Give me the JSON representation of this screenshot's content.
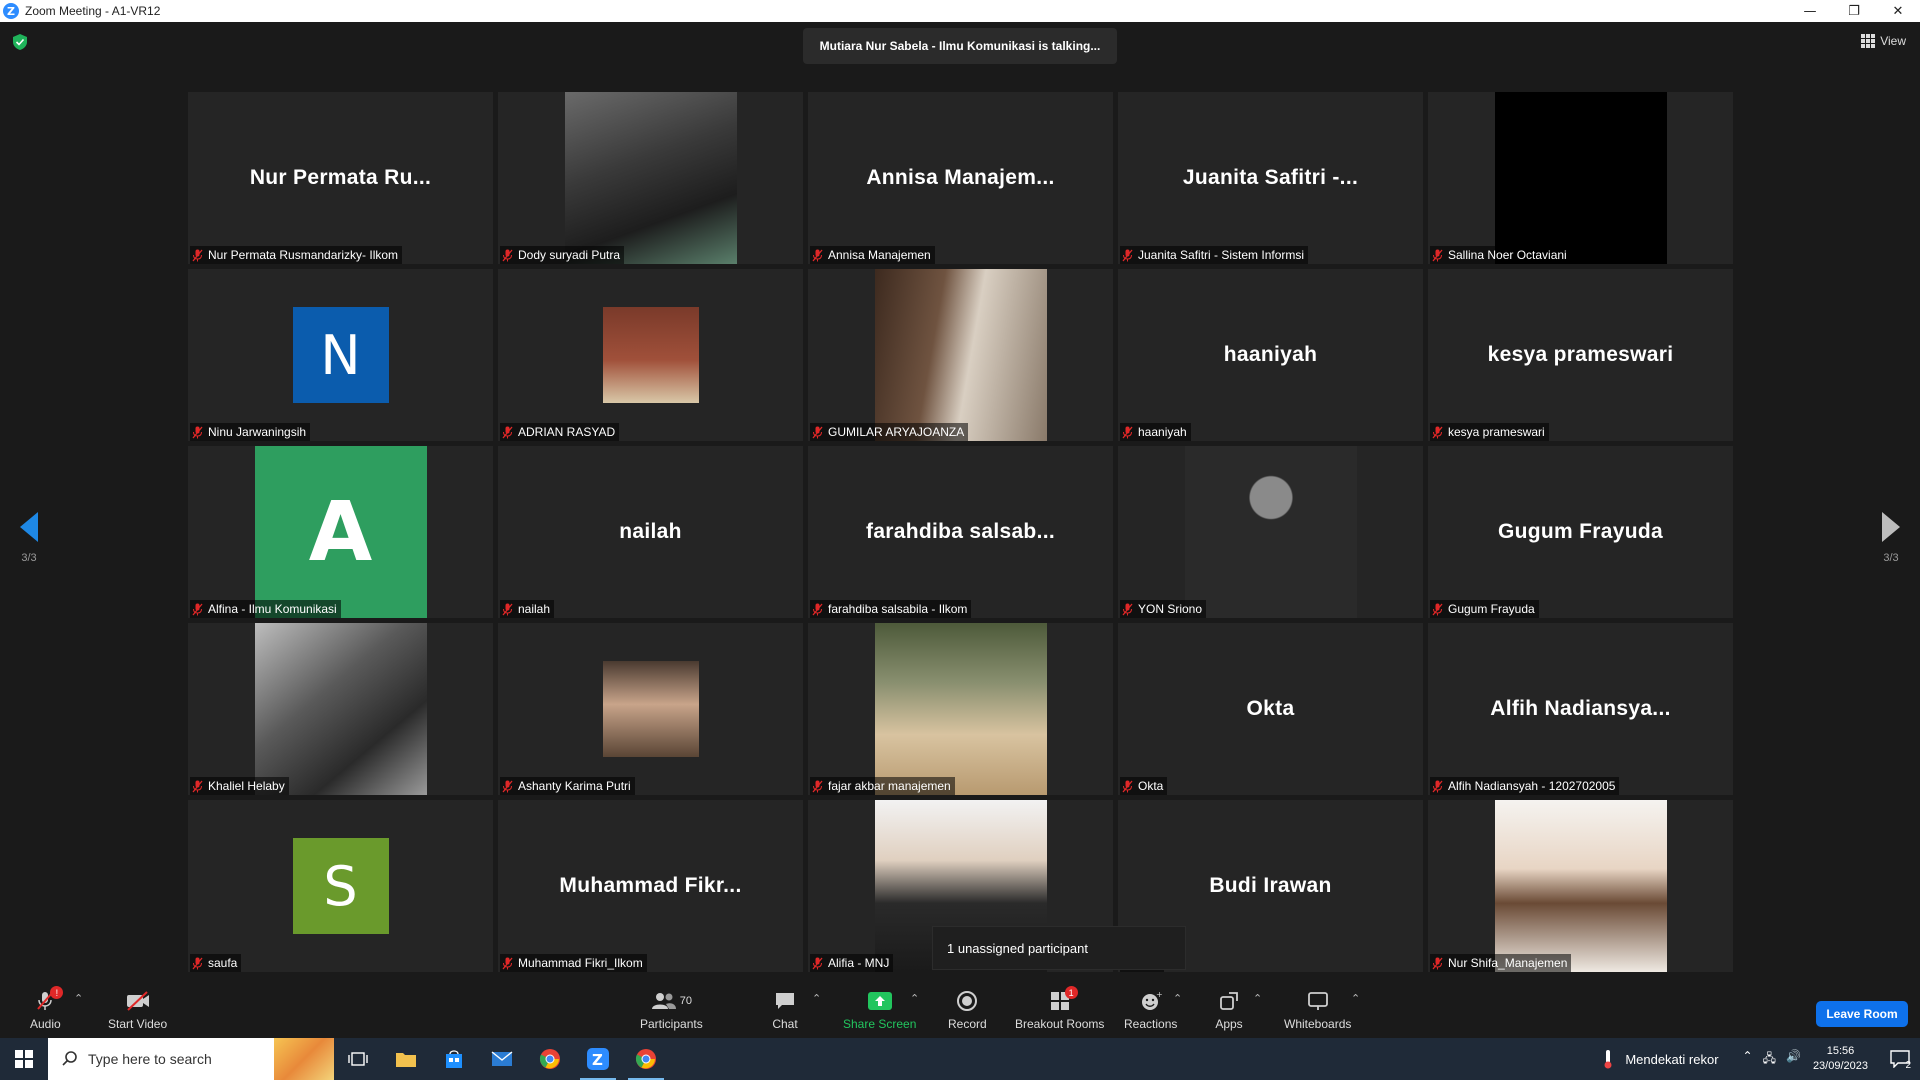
{
  "window": {
    "title": "Zoom Meeting - A1-VR12",
    "logo_letter": "Z",
    "minimize": "—",
    "restore": "❐",
    "close": "✕"
  },
  "meeting": {
    "talking_indicator": "Mutiara Nur Sabela - Ilmu Komunikasi is talking...",
    "view_label": "View",
    "page_indicator_left": "3/3",
    "page_indicator_right": "3/3",
    "unassigned_tooltip": "1 unassigned participant"
  },
  "tiles": [
    {
      "big_name": "Nur Permata Ru...",
      "label": "Nur Permata Rusmandarizky- Ilkom",
      "kind": "name"
    },
    {
      "big_name": "",
      "label": "Dody suryadi Putra",
      "kind": "photo",
      "photo": "band-performer"
    },
    {
      "big_name": "Annisa  Manajem...",
      "label": "Annisa Manajemen",
      "kind": "name"
    },
    {
      "big_name": "Juanita Safitri -...",
      "label": "Juanita Safitri - Sistem Informsi",
      "kind": "name"
    },
    {
      "big_name": "",
      "label": "Sallina Noer Octaviani",
      "kind": "black"
    },
    {
      "letter": "N",
      "label": "Ninu Jarwaningsih",
      "kind": "letter",
      "color": "#0b5cad"
    },
    {
      "big_name": "",
      "label": "ADRIAN RASYAD",
      "kind": "photo-small",
      "photo": "man-red-wall"
    },
    {
      "big_name": "",
      "label": "GUMILAR ARYAJOANZA",
      "kind": "photo",
      "photo": "mirror-selfie"
    },
    {
      "big_name": "haaniyah",
      "label": "haaniyah",
      "kind": "name"
    },
    {
      "big_name": "kesya prameswari",
      "label": "kesya prameswari",
      "kind": "name"
    },
    {
      "letter": "A",
      "label": "Alfina - Ilmu Komunikasi",
      "kind": "letter-big",
      "color": "#2e9e5f"
    },
    {
      "big_name": "nailah",
      "label": "nailah",
      "kind": "name"
    },
    {
      "big_name": "farahdiba  salsab...",
      "label": "farahdiba salsabila - Ilkom",
      "kind": "name"
    },
    {
      "big_name": "",
      "label": "YON Sriono",
      "kind": "photo",
      "photo": "man-plaid-shirt"
    },
    {
      "big_name": "Gugum Frayuda",
      "label": "Gugum Frayuda",
      "kind": "name"
    },
    {
      "big_name": "",
      "label": "Khaliel Helaby",
      "kind": "photo",
      "photo": "drum-kit"
    },
    {
      "big_name": "",
      "label": "Ashanty Karima Putri",
      "kind": "photo-small",
      "photo": "woman-selfie"
    },
    {
      "big_name": "",
      "label": "fajar akbar manajemen",
      "kind": "photo",
      "photo": "beach-guitar"
    },
    {
      "big_name": "Okta",
      "label": "Okta",
      "kind": "name"
    },
    {
      "big_name": "Alfih  Nadiansya...",
      "label": "Alfih Nadiansyah - 1202702005",
      "kind": "name"
    },
    {
      "letter": "S",
      "label": "saufa",
      "kind": "letter",
      "color": "#6a9a2c"
    },
    {
      "big_name": "Muhammad  Fikr...",
      "label": "Muhammad Fikri_Ilkom",
      "kind": "name"
    },
    {
      "big_name": "",
      "label": "Alifia - MNJ",
      "kind": "photo",
      "photo": "woman-hijab"
    },
    {
      "big_name": "Budi Irawan",
      "label": "wan",
      "kind": "name"
    },
    {
      "big_name": "",
      "label": "Nur Shifa_Manajemen",
      "kind": "photo",
      "photo": "woman-portrait"
    }
  ],
  "toolbar": {
    "audio": "Audio",
    "start_video": "Start Video",
    "participants": "Participants",
    "participants_count": "70",
    "chat": "Chat",
    "share_screen": "Share Screen",
    "record": "Record",
    "breakout_rooms": "Breakout Rooms",
    "breakout_badge": "1",
    "reactions": "Reactions",
    "apps": "Apps",
    "whiteboards": "Whiteboards",
    "leave_room": "Leave Room",
    "audio_badge": "!"
  },
  "taskbar": {
    "search_placeholder": "Type here to search",
    "weather_text": "Mendekati rekor",
    "time": "15:56",
    "date": "23/09/2023",
    "notification_count": "2"
  },
  "colors": {
    "accent_blue": "#0e71eb",
    "share_green": "#22c55e",
    "muted_red": "#e02828"
  }
}
